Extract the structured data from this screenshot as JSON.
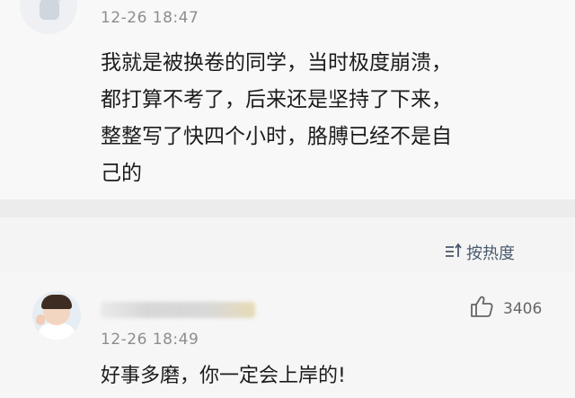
{
  "top_comment": {
    "timestamp": "12-26 18:47",
    "lines": [
      "我就是被换卷的同学，当时极度崩溃，",
      "都打算不考了，后来还是坚持了下来，",
      "整整写了快四个小时，胳膊已经不是自",
      "己的"
    ]
  },
  "sort": {
    "label": "按热度",
    "icon": "sort-icon"
  },
  "reply_comment": {
    "like_count": "3406",
    "like_icon": "thumbs-up-icon",
    "timestamp": "12-26 18:49",
    "text": "好事多磨，你一定会上岸的!"
  }
}
